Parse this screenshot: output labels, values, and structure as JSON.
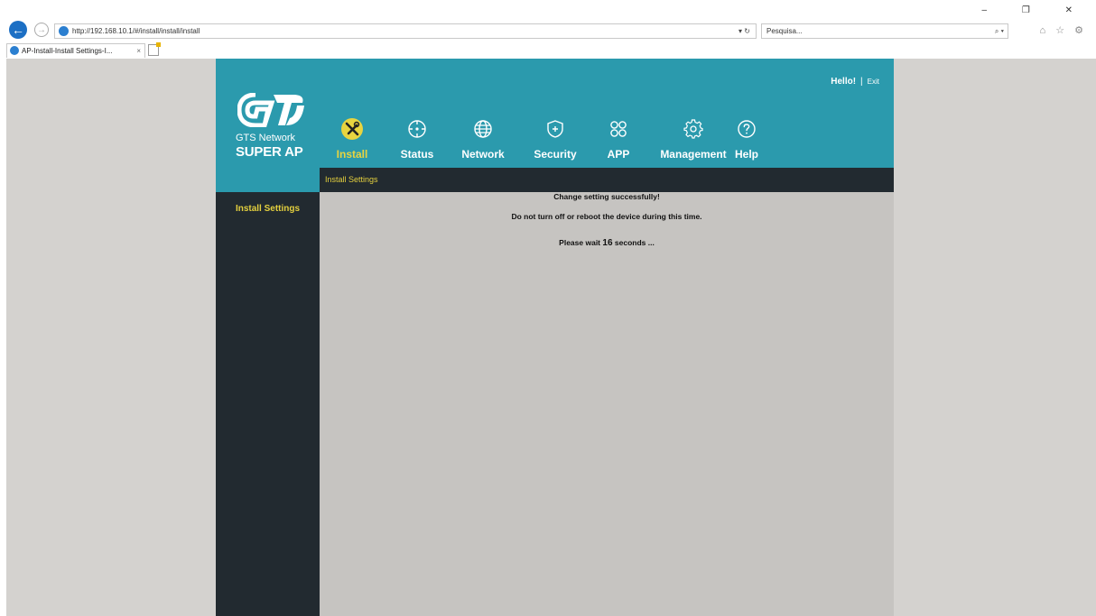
{
  "browser": {
    "url": "http://192.168.10.1/#/install/install/install",
    "url_actions": "▾ ↻",
    "search_placeholder": "Pesquisa...",
    "search_icon": "⌕ ▾",
    "tab_title": "AP-Install-Install Settings-I...",
    "tab_close": "×",
    "window_controls": "– ❐ ✕",
    "toolbar_icons": "⌂ ☆ ⚙"
  },
  "header": {
    "hello": "Hello!",
    "separator": "|",
    "exit": "Exit",
    "brand_line1": "GTS Network",
    "brand_line2": "SUPER AP",
    "accent": "#2b9aad",
    "active_color": "#e8d440"
  },
  "nav": [
    {
      "label": "Install",
      "icon": "tools-icon",
      "active": true
    },
    {
      "label": "Status",
      "icon": "crosshair-icon"
    },
    {
      "label": "Network",
      "icon": "globe-icon"
    },
    {
      "label": "Security",
      "icon": "shield-icon"
    },
    {
      "label": "APP",
      "icon": "apps-icon"
    },
    {
      "label": "Management",
      "icon": "gear-icon"
    },
    {
      "label": "Help",
      "icon": "help-icon"
    }
  ],
  "subnav": {
    "label": "Install Settings"
  },
  "sidebar": {
    "items": [
      {
        "label": "Install Settings"
      }
    ]
  },
  "content": {
    "line1": "Change setting successfully!",
    "line2": "Do not turn off or reboot the device during this time.",
    "wait_prefix": "Please wait",
    "wait_count": "16",
    "wait_suffix": "seconds ..."
  }
}
